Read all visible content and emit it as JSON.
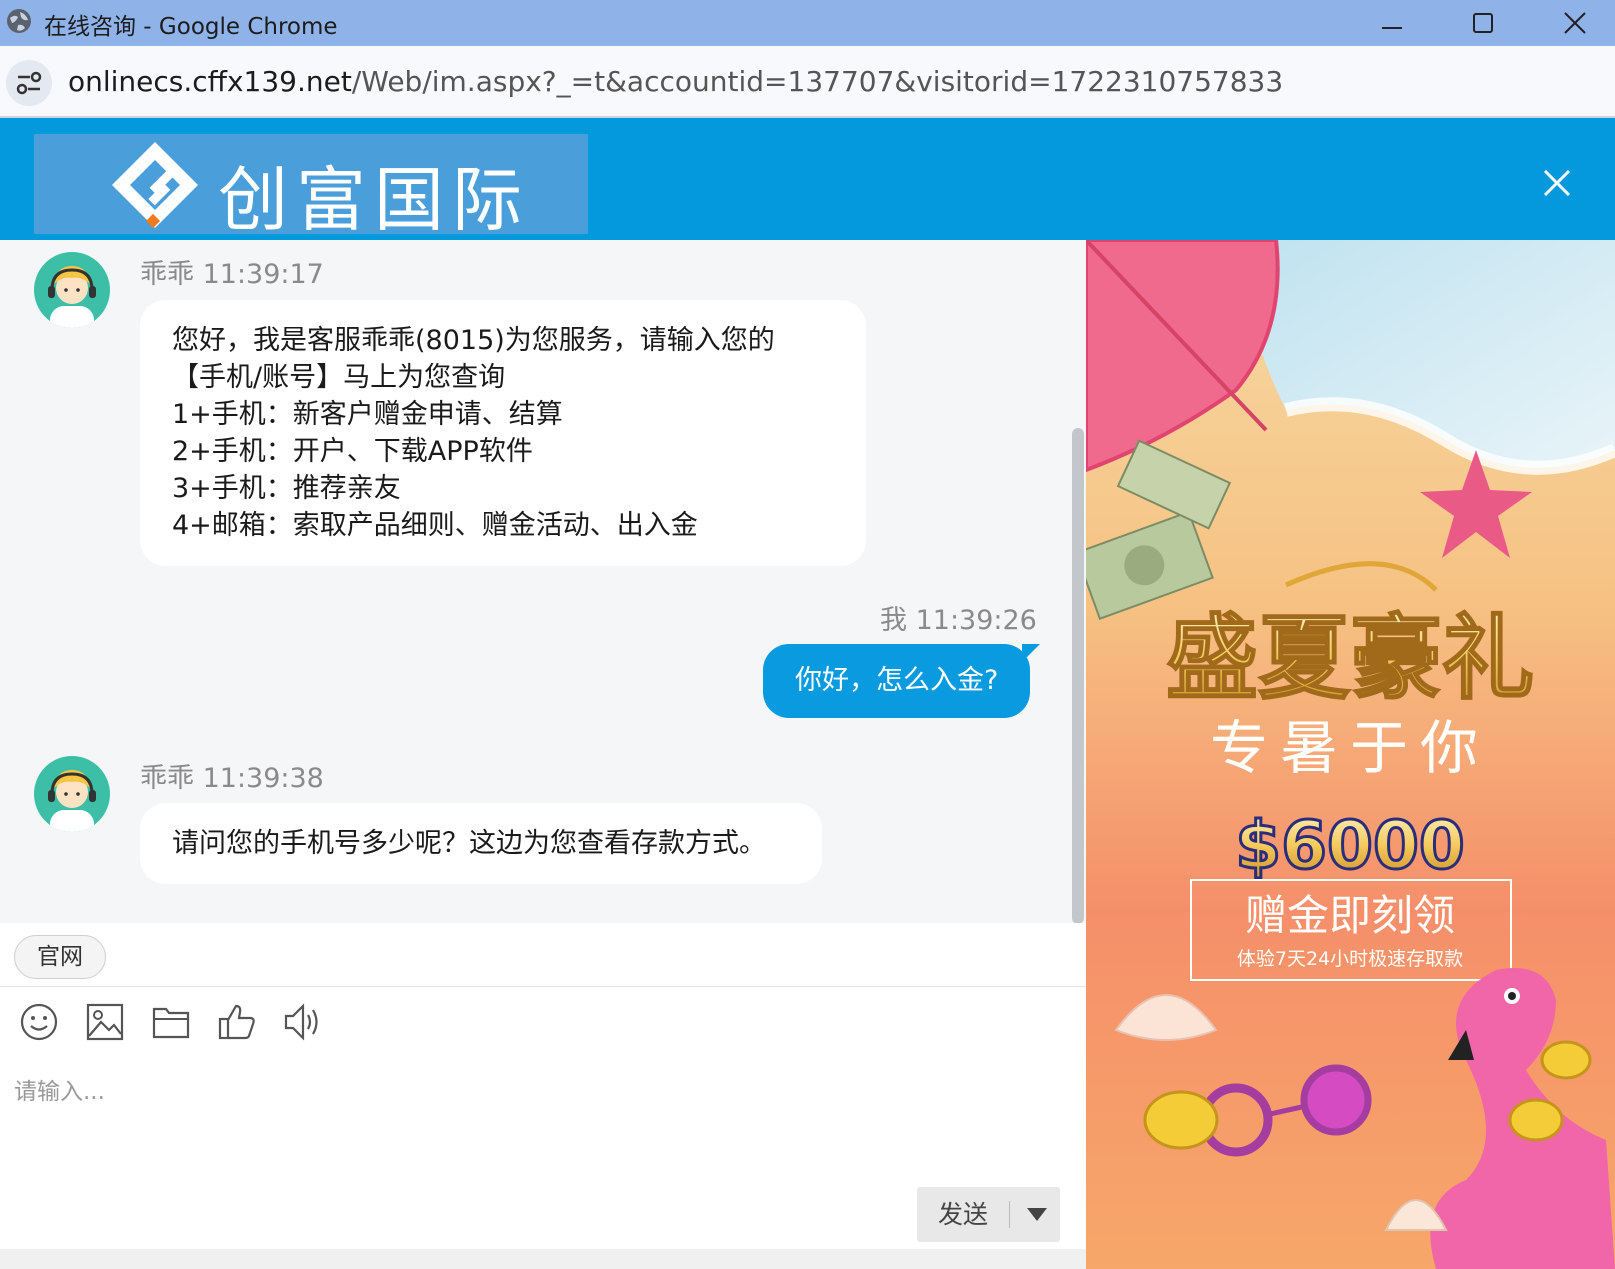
{
  "window": {
    "title": "在线咨询 - Google Chrome",
    "url_domain": "onlinecs.cffx139.net",
    "url_path": "/Web/im.aspx?_=t&accountid=137707&visitorid=1722310757833"
  },
  "header": {
    "logo_text": "创富国际"
  },
  "messages": [
    {
      "sender": "乖乖",
      "time": "11:39:17",
      "meta": "乖乖 11:39:17",
      "lines": [
        "您好，我是客服乖乖(8015)为您服务，请输入您的",
        "【手机/账号】马上为您查询",
        "1+手机：新客户赠金申请、结算",
        "2+手机：开户、下载APP软件",
        "3+手机：推荐亲友",
        "4+邮箱：索取产品细则、赠金活动、出入金"
      ]
    },
    {
      "sender": "我",
      "time": "11:39:26",
      "meta": "我 11:39:26",
      "text": "你好，怎么入金?"
    },
    {
      "sender": "乖乖",
      "time": "11:39:38",
      "meta": "乖乖 11:39:38",
      "lines": [
        "请问您的手机号多少呢？这边为您查看存款方式。"
      ]
    }
  ],
  "quick_links": [
    "官网"
  ],
  "toolbar": {
    "icons": [
      "emoji-icon",
      "image-icon",
      "folder-icon",
      "thumbs-up-icon",
      "speaker-icon"
    ]
  },
  "input": {
    "placeholder": "请输入...",
    "value": ""
  },
  "send": {
    "label": "发送"
  },
  "promo": {
    "headline": "盛夏豪礼",
    "subheadline": "专暑于你",
    "amount": "$6000",
    "offer": "赠金即刻领",
    "tagline": "体验7天24小时极速存取款"
  },
  "colors": {
    "titlebar": "#8fb3e8",
    "header": "#0499dd",
    "outgoing_bubble": "#0a9ae0",
    "chat_bg": "#f4f6f8"
  }
}
